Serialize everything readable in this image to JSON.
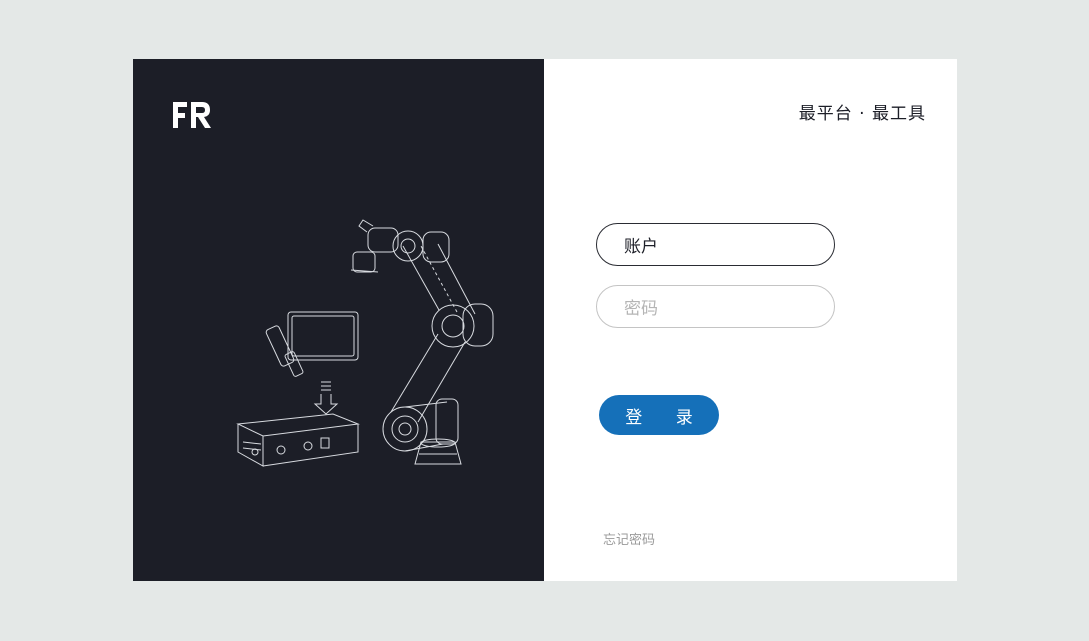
{
  "brand": {
    "logo_text": "FR",
    "slogan": "最平台 · 最工具"
  },
  "login_form": {
    "account_placeholder": "账户",
    "password_placeholder": "密码",
    "login_label": "登 录",
    "forgot_label": "忘记密码"
  },
  "colors": {
    "left_panel_bg": "#1c1e27",
    "page_bg": "#e4e8e7",
    "accent": "#1570b9"
  },
  "illustration": {
    "description_icon": "robot-arm-icon"
  }
}
